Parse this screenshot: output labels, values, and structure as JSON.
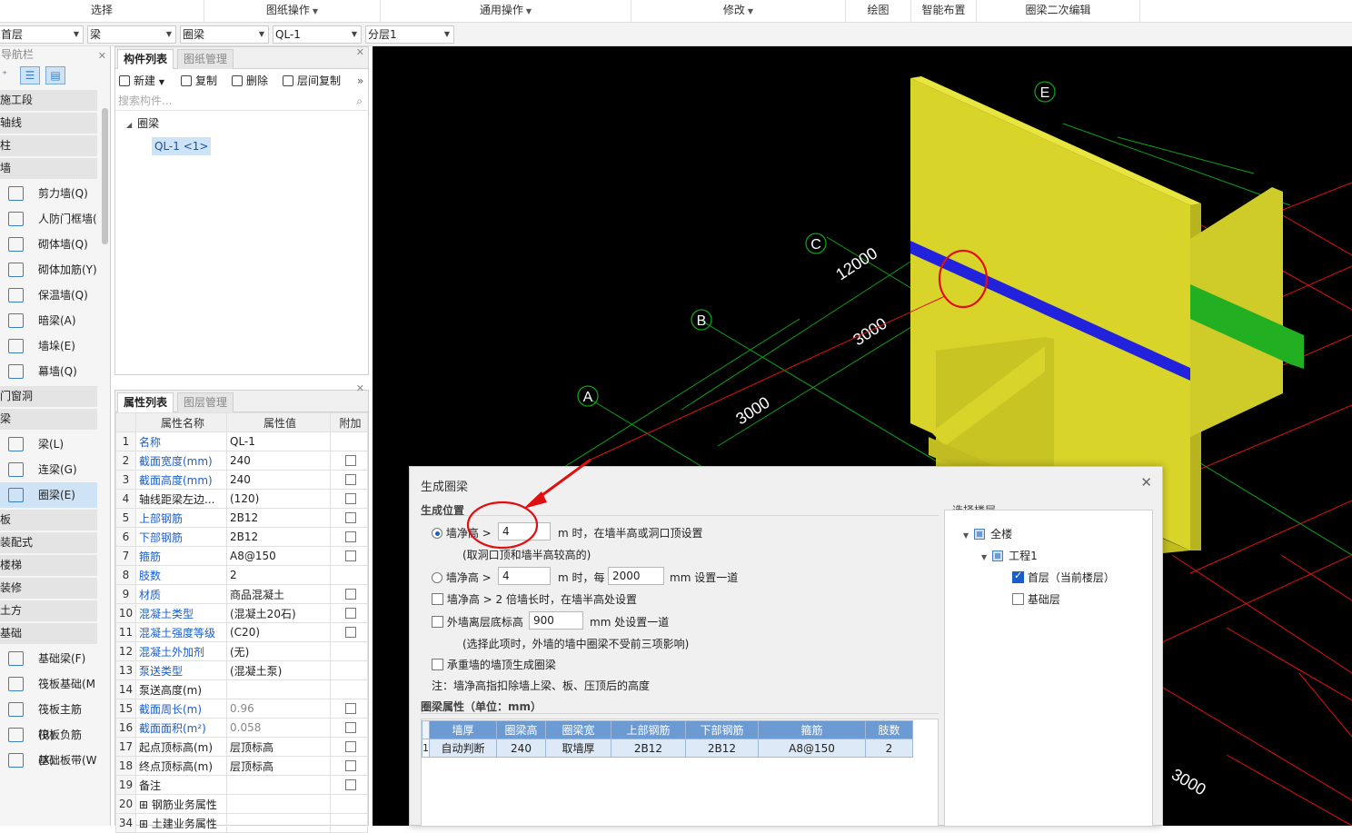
{
  "ribbon": {
    "select": "选择",
    "drawing_ops": "图纸操作",
    "general_ops": "通用操作",
    "modify": "修改",
    "draw": "绘图",
    "smart_layout": "智能布置",
    "beam_edit": "圈梁二次编辑"
  },
  "selectors": {
    "floor": "首层",
    "category": "梁",
    "type": "圈梁",
    "component": "QL-1",
    "layer": "分层1"
  },
  "nav": {
    "title": "导航栏",
    "items": [
      {
        "kind": "cat",
        "label": "施工段"
      },
      {
        "kind": "cat",
        "label": "轴线"
      },
      {
        "kind": "cat",
        "label": "柱"
      },
      {
        "kind": "cat",
        "label": "墙"
      },
      {
        "kind": "sub",
        "label": "剪力墙(Q)",
        "icon": "shear-wall-icon"
      },
      {
        "kind": "sub",
        "label": "人防门框墙(",
        "icon": "civil-defense-door-wall-icon"
      },
      {
        "kind": "sub",
        "label": "砌体墙(Q)",
        "icon": "masonry-wall-icon"
      },
      {
        "kind": "sub",
        "label": "砌体加筋(Y)",
        "icon": "masonry-reinforcement-icon"
      },
      {
        "kind": "sub",
        "label": "保温墙(Q)",
        "icon": "insulation-wall-icon"
      },
      {
        "kind": "sub",
        "label": "暗梁(A)",
        "icon": "hidden-beam-icon"
      },
      {
        "kind": "sub",
        "label": "墙垛(E)",
        "icon": "wall-pier-icon"
      },
      {
        "kind": "sub",
        "label": "幕墙(Q)",
        "icon": "curtain-wall-icon"
      },
      {
        "kind": "cat",
        "label": "门窗洞"
      },
      {
        "kind": "cat",
        "label": "梁"
      },
      {
        "kind": "sub",
        "label": "梁(L)",
        "icon": "beam-icon"
      },
      {
        "kind": "sub",
        "label": "连梁(G)",
        "icon": "coupling-beam-icon"
      },
      {
        "kind": "sub",
        "label": "圈梁(E)",
        "icon": "ring-beam-icon",
        "active": true
      },
      {
        "kind": "cat",
        "label": "板"
      },
      {
        "kind": "cat",
        "label": "装配式"
      },
      {
        "kind": "cat",
        "label": "楼梯"
      },
      {
        "kind": "cat",
        "label": "装修"
      },
      {
        "kind": "cat",
        "label": "土方"
      },
      {
        "kind": "cat",
        "label": "基础"
      },
      {
        "kind": "sub",
        "label": "基础梁(F)",
        "icon": "foundation-beam-icon"
      },
      {
        "kind": "sub",
        "label": "筏板基础(M",
        "icon": "raft-foundation-icon"
      },
      {
        "kind": "sub",
        "label": "筏板主筋(R)",
        "icon": "raft-main-rebar-icon"
      },
      {
        "kind": "sub",
        "label": "筏板负筋(X)",
        "icon": "raft-negative-rebar-icon"
      },
      {
        "kind": "sub",
        "label": "基础板带(W",
        "icon": "foundation-strip-icon"
      }
    ]
  },
  "component_panel": {
    "tab_list": "构件列表",
    "tab_drawings": "图纸管理",
    "new": "新建",
    "copy": "复制",
    "delete": "删除",
    "floor_copy": "层间复制",
    "search_placeholder": "搜索构件...",
    "tree_root": "圈梁",
    "tree_item": "QL-1 <1>"
  },
  "property_panel": {
    "tab_props": "属性列表",
    "tab_layers": "图层管理",
    "col_name": "属性名称",
    "col_value": "属性值",
    "col_extra": "附加",
    "rows": [
      {
        "n": "1",
        "name": "名称",
        "value": "QL-1",
        "blue": true,
        "cb": false
      },
      {
        "n": "2",
        "name": "截面宽度(mm)",
        "value": "240",
        "blue": true,
        "cb": true
      },
      {
        "n": "3",
        "name": "截面高度(mm)",
        "value": "240",
        "blue": true,
        "cb": true
      },
      {
        "n": "4",
        "name": "轴线距梁左边...",
        "value": "(120)",
        "blue": false,
        "cb": true
      },
      {
        "n": "5",
        "name": "上部钢筋",
        "value": "2B12",
        "blue": true,
        "cb": true
      },
      {
        "n": "6",
        "name": "下部钢筋",
        "value": "2B12",
        "blue": true,
        "cb": true
      },
      {
        "n": "7",
        "name": "箍筋",
        "value": "A8@150",
        "blue": true,
        "cb": true
      },
      {
        "n": "8",
        "name": "肢数",
        "value": "2",
        "blue": true,
        "cb": false
      },
      {
        "n": "9",
        "name": "材质",
        "value": "商品混凝土",
        "blue": true,
        "cb": true
      },
      {
        "n": "10",
        "name": "混凝土类型",
        "value": "(混凝土20石)",
        "blue": true,
        "cb": true
      },
      {
        "n": "11",
        "name": "混凝土强度等级",
        "value": "(C20)",
        "blue": true,
        "cb": true
      },
      {
        "n": "12",
        "name": "混凝土外加剂",
        "value": "(无)",
        "blue": true,
        "cb": false
      },
      {
        "n": "13",
        "name": "泵送类型",
        "value": "(混凝土泵)",
        "blue": true,
        "cb": false
      },
      {
        "n": "14",
        "name": "泵送高度(m)",
        "value": "",
        "blue": false,
        "cb": false
      },
      {
        "n": "15",
        "name": "截面周长(m)",
        "value": "0.96",
        "blue": true,
        "gray": true,
        "cb": true
      },
      {
        "n": "16",
        "name": "截面面积(m²)",
        "value": "0.058",
        "blue": true,
        "gray": true,
        "cb": true
      },
      {
        "n": "17",
        "name": "起点顶标高(m)",
        "value": "层顶标高",
        "blue": false,
        "cb": true
      },
      {
        "n": "18",
        "name": "终点顶标高(m)",
        "value": "层顶标高",
        "blue": false,
        "cb": true
      },
      {
        "n": "19",
        "name": "备注",
        "value": "",
        "blue": false,
        "cb": true
      },
      {
        "n": "20",
        "name": "钢筋业务属性",
        "value": "",
        "blue": false,
        "cb": false,
        "expand": true
      },
      {
        "n": "34",
        "name": "土建业务属性",
        "value": "",
        "blue": false,
        "cb": false,
        "expand": true
      }
    ]
  },
  "viewport": {
    "axis_labels": [
      "A",
      "B",
      "C",
      "E"
    ],
    "dims": [
      "12000",
      "3000",
      "3000",
      "3000"
    ]
  },
  "dialog": {
    "title": "生成圈梁",
    "section_position": "生成位置",
    "opt1_label": "墙净高 >",
    "opt1_value": "4",
    "opt1_suffix": "m 时，在墙半高或洞口顶设置",
    "opt1_note": "(取洞口顶和墙半高较高的)",
    "opt2_label": "墙净高 >",
    "opt2_value": "4",
    "opt2_mid": "m 时，每",
    "opt2_value2": "2000",
    "opt2_suffix": "mm 设置一道",
    "chk1": "墙净高 > 2 倍墙长时，在墙半高处设置",
    "chk2_label": "外墙离层底标高",
    "chk2_value": "900",
    "chk2_suffix": "mm 处设置一道",
    "chk2_note": "(选择此项时，外墙的墙中圈梁不受前三项影响)",
    "chk3": "承重墙的墙顶生成圈梁",
    "note": "注：墙净高指扣除墙上梁、板、压顶后的高度",
    "section_props": "圈梁属性（单位：mm）",
    "table_headers": [
      "墙厚",
      "圈梁高",
      "圈梁宽",
      "上部钢筋",
      "下部钢筋",
      "箍筋",
      "肢数"
    ],
    "table_row": [
      "自动判断",
      "240",
      "取墙厚",
      "2B12",
      "2B12",
      "A8@150",
      "2"
    ],
    "table_rownum": "1",
    "section_floors": "选择楼层",
    "tree_all": "全楼",
    "tree_project": "工程1",
    "tree_floor1": "首层（当前楼层）",
    "tree_base": "基础层"
  }
}
